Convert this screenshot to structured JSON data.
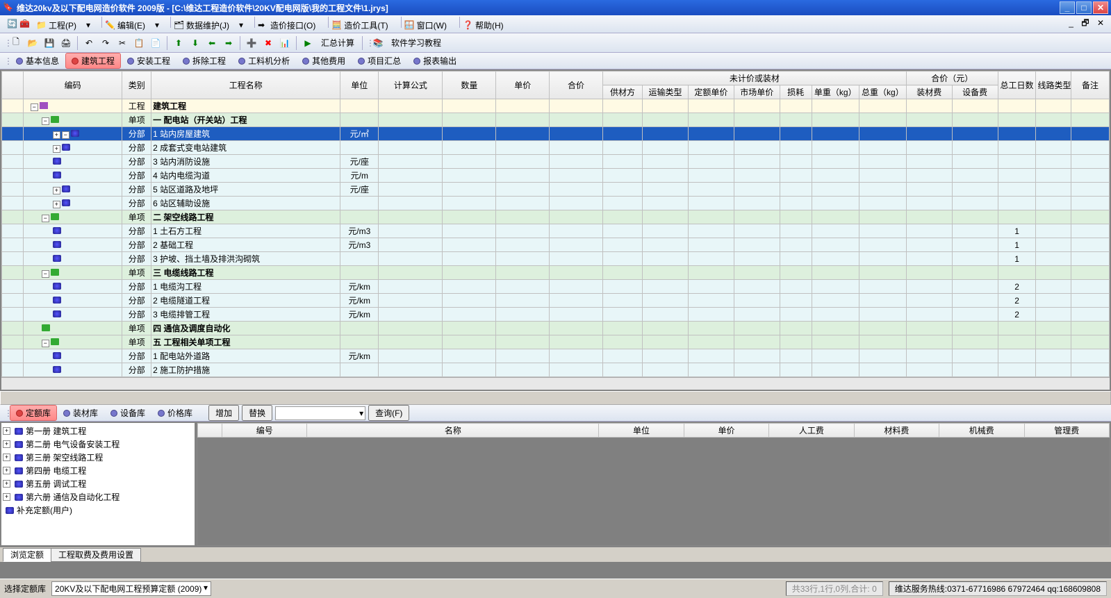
{
  "window": {
    "title": "维达20kv及以下配电网造价软件 2009版 - [C:\\维达工程造价软件\\20KV配电网版\\我的工程文件\\1.jrys]"
  },
  "menu": {
    "items": [
      "工程(P)",
      "编辑(E)",
      "数据维护(J)",
      "造价接口(O)",
      "造价工具(T)",
      "窗口(W)",
      "帮助(H)"
    ]
  },
  "toolbar": {
    "calc_label": "汇总计算",
    "tutorial_label": "软件学习教程"
  },
  "main_tabs": [
    "基本信息",
    "建筑工程",
    "安装工程",
    "拆除工程",
    "工料机分析",
    "其他费用",
    "项目汇总",
    "报表输出"
  ],
  "main_tab_active": 1,
  "grid": {
    "group1": "未计价或装材",
    "group2": "合价（元）",
    "headers": [
      "编码",
      "类别",
      "工程名称",
      "单位",
      "计算公式",
      "数量",
      "单价",
      "合价",
      "供材方",
      "运输类型",
      "定额单价",
      "市场单价",
      "损耗",
      "单重（kg）",
      "总重（kg）",
      "装材费",
      "设备费",
      "总工日数",
      "线路类型",
      "备注"
    ],
    "rows": [
      {
        "cls": "row-yellow",
        "ind": 0,
        "exp": "-",
        "ico": "red",
        "type": "工程",
        "name": "建筑工程",
        "unit": "",
        "days": ""
      },
      {
        "cls": "row-green",
        "ind": 1,
        "exp": "-",
        "ico": "grn",
        "type": "单项",
        "name": "一  配电站（开关站）工程",
        "unit": "",
        "days": ""
      },
      {
        "cls": "row-sel",
        "ind": 2,
        "exp": "+-",
        "ico": "blu",
        "type": "分部",
        "name": "1  站内房屋建筑",
        "unit": "元/㎡",
        "days": ""
      },
      {
        "cls": "row-blue",
        "ind": 2,
        "exp": "+",
        "ico": "blu",
        "type": "分部",
        "name": "2  成套式变电站建筑",
        "unit": "",
        "days": ""
      },
      {
        "cls": "row-blue",
        "ind": 2,
        "exp": "",
        "ico": "blu",
        "type": "分部",
        "name": "3  站内消防设施",
        "unit": "元/座",
        "days": ""
      },
      {
        "cls": "row-blue",
        "ind": 2,
        "exp": "",
        "ico": "blu",
        "type": "分部",
        "name": "4  站内电缆沟道",
        "unit": "元/m",
        "days": ""
      },
      {
        "cls": "row-blue",
        "ind": 2,
        "exp": "+",
        "ico": "blu",
        "type": "分部",
        "name": "5  站区道路及地坪",
        "unit": "元/座",
        "days": ""
      },
      {
        "cls": "row-blue",
        "ind": 2,
        "exp": "+",
        "ico": "blu",
        "type": "分部",
        "name": "6  站区辅助设施",
        "unit": "",
        "days": ""
      },
      {
        "cls": "row-green",
        "ind": 1,
        "exp": "-",
        "ico": "grn",
        "type": "单项",
        "name": "二  架空线路工程",
        "unit": "",
        "days": ""
      },
      {
        "cls": "row-blue",
        "ind": 2,
        "exp": "",
        "ico": "blu",
        "type": "分部",
        "name": "1  土石方工程",
        "unit": "元/m3",
        "days": "1"
      },
      {
        "cls": "row-blue",
        "ind": 2,
        "exp": "",
        "ico": "blu",
        "type": "分部",
        "name": "2  基础工程",
        "unit": "元/m3",
        "days": "1"
      },
      {
        "cls": "row-blue",
        "ind": 2,
        "exp": "",
        "ico": "blu",
        "type": "分部",
        "name": "3  护坡、挡土墙及排洪沟砌筑",
        "unit": "",
        "days": "1"
      },
      {
        "cls": "row-green",
        "ind": 1,
        "exp": "-",
        "ico": "grn",
        "type": "单项",
        "name": "三  电缆线路工程",
        "unit": "",
        "days": ""
      },
      {
        "cls": "row-blue",
        "ind": 2,
        "exp": "",
        "ico": "blu",
        "type": "分部",
        "name": "1  电缆沟工程",
        "unit": "元/km",
        "days": "2"
      },
      {
        "cls": "row-blue",
        "ind": 2,
        "exp": "",
        "ico": "blu",
        "type": "分部",
        "name": "2  电缆隧道工程",
        "unit": "元/km",
        "days": "2"
      },
      {
        "cls": "row-blue",
        "ind": 2,
        "exp": "",
        "ico": "blu",
        "type": "分部",
        "name": "3  电缆排管工程",
        "unit": "元/km",
        "days": "2"
      },
      {
        "cls": "row-green",
        "ind": 1,
        "exp": "",
        "ico": "grn",
        "type": "单项",
        "name": "四  通信及调度自动化",
        "unit": "",
        "days": ""
      },
      {
        "cls": "row-green",
        "ind": 1,
        "exp": "-",
        "ico": "grn",
        "type": "单项",
        "name": "五  工程相关单项工程",
        "unit": "",
        "days": ""
      },
      {
        "cls": "row-blue",
        "ind": 2,
        "exp": "",
        "ico": "blu",
        "type": "分部",
        "name": "1  配电站外道路",
        "unit": "元/km",
        "days": ""
      },
      {
        "cls": "row-blue",
        "ind": 2,
        "exp": "",
        "ico": "blu",
        "type": "分部",
        "name": "2  施工防护措施",
        "unit": "",
        "days": ""
      }
    ]
  },
  "lower_tabs": [
    "定额库",
    "装材库",
    "设备库",
    "价格库"
  ],
  "lower_tab_active": 0,
  "lower_actions": {
    "add": "增加",
    "replace": "替换",
    "query": "查询(F)"
  },
  "tree": [
    "第一册  建筑工程",
    "第二册  电气设备安装工程",
    "第三册  架空线路工程",
    "第四册  电缆工程",
    "第五册  调试工程",
    "第六册  通信及自动化工程",
    "补充定额(用户)"
  ],
  "list_headers": [
    "编号",
    "名称",
    "单位",
    "单价",
    "人工费",
    "材料费",
    "机械费",
    "管理费"
  ],
  "bottom_tabs": [
    "浏览定额",
    "工程取费及费用设置"
  ],
  "bottom_tab_active": 0,
  "status": {
    "label": "选择定额库",
    "combo": "20KV及以下配电网工程预算定额 (2009)",
    "stat": "共33行,1行,0列,合计: 0",
    "hotline": "维达服务热线:0371-67716986 67972464 qq:168609808"
  }
}
